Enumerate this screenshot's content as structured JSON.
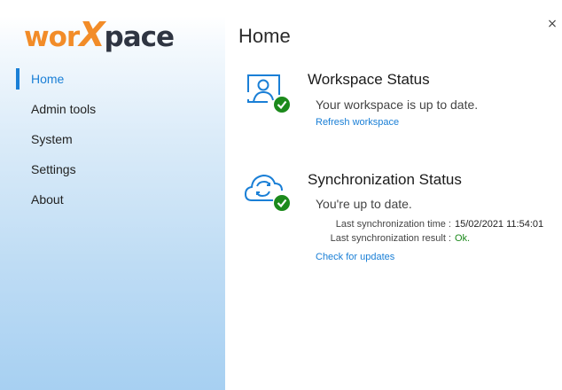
{
  "app": {
    "logo_text": "worXpace",
    "close_glyph": "×"
  },
  "sidebar": {
    "items": [
      {
        "label": "Home",
        "active": true
      },
      {
        "label": "Admin tools",
        "active": false
      },
      {
        "label": "System",
        "active": false
      },
      {
        "label": "Settings",
        "active": false
      },
      {
        "label": "About",
        "active": false
      }
    ]
  },
  "main": {
    "title": "Home",
    "workspace": {
      "icon": "workspace-monitor-check-icon",
      "title": "Workspace Status",
      "message": "Your workspace is up to date.",
      "link": "Refresh workspace"
    },
    "sync": {
      "icon": "cloud-sync-check-icon",
      "title": "Synchronization Status",
      "message": "You're up to date.",
      "last_time_label": "Last synchronization time :",
      "last_time_value": "15/02/2021 11:54:01",
      "last_result_label": "Last synchronization result :",
      "last_result_value": "Ok.",
      "link": "Check for updates"
    }
  },
  "colors": {
    "accent": "#1a7fd6",
    "brand_orange": "#f28c28",
    "success_green": "#1c8a1c"
  }
}
